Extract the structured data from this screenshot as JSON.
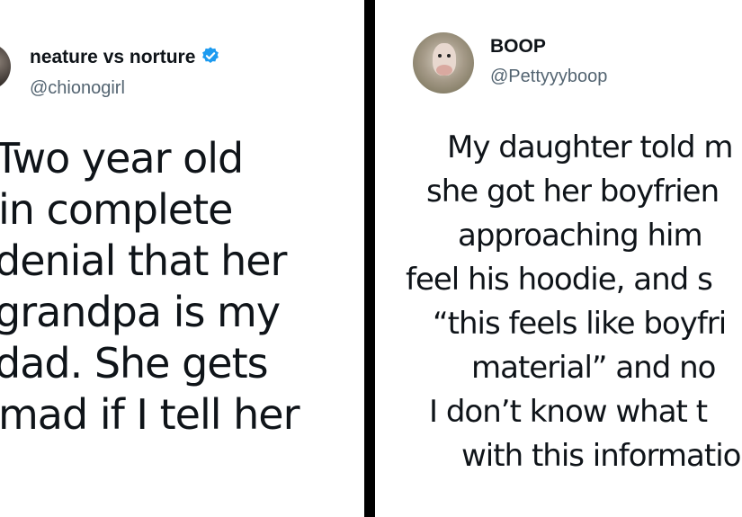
{
  "tweets": [
    {
      "display_name": "neature vs norture",
      "handle": "@chionogirl",
      "verified": true,
      "accent_color": "#1d9bf0",
      "avatar_icon": "profile-photo",
      "text_lines": [
        "Two year old",
        "in complete",
        "denial that her",
        "grandpa is my",
        "dad. She gets",
        "mad if I tell her"
      ]
    },
    {
      "display_name": "BOOP",
      "handle": "@Pettyyyboop",
      "verified": false,
      "avatar_icon": "pig-photo",
      "text_lines": [
        "My daughter told m",
        "she got her boyfrien",
        "approaching him",
        "feel his hoodie, and s",
        "“this feels like boyfri",
        "material” and no",
        "I don’t know what t",
        "with this informatio"
      ]
    }
  ]
}
